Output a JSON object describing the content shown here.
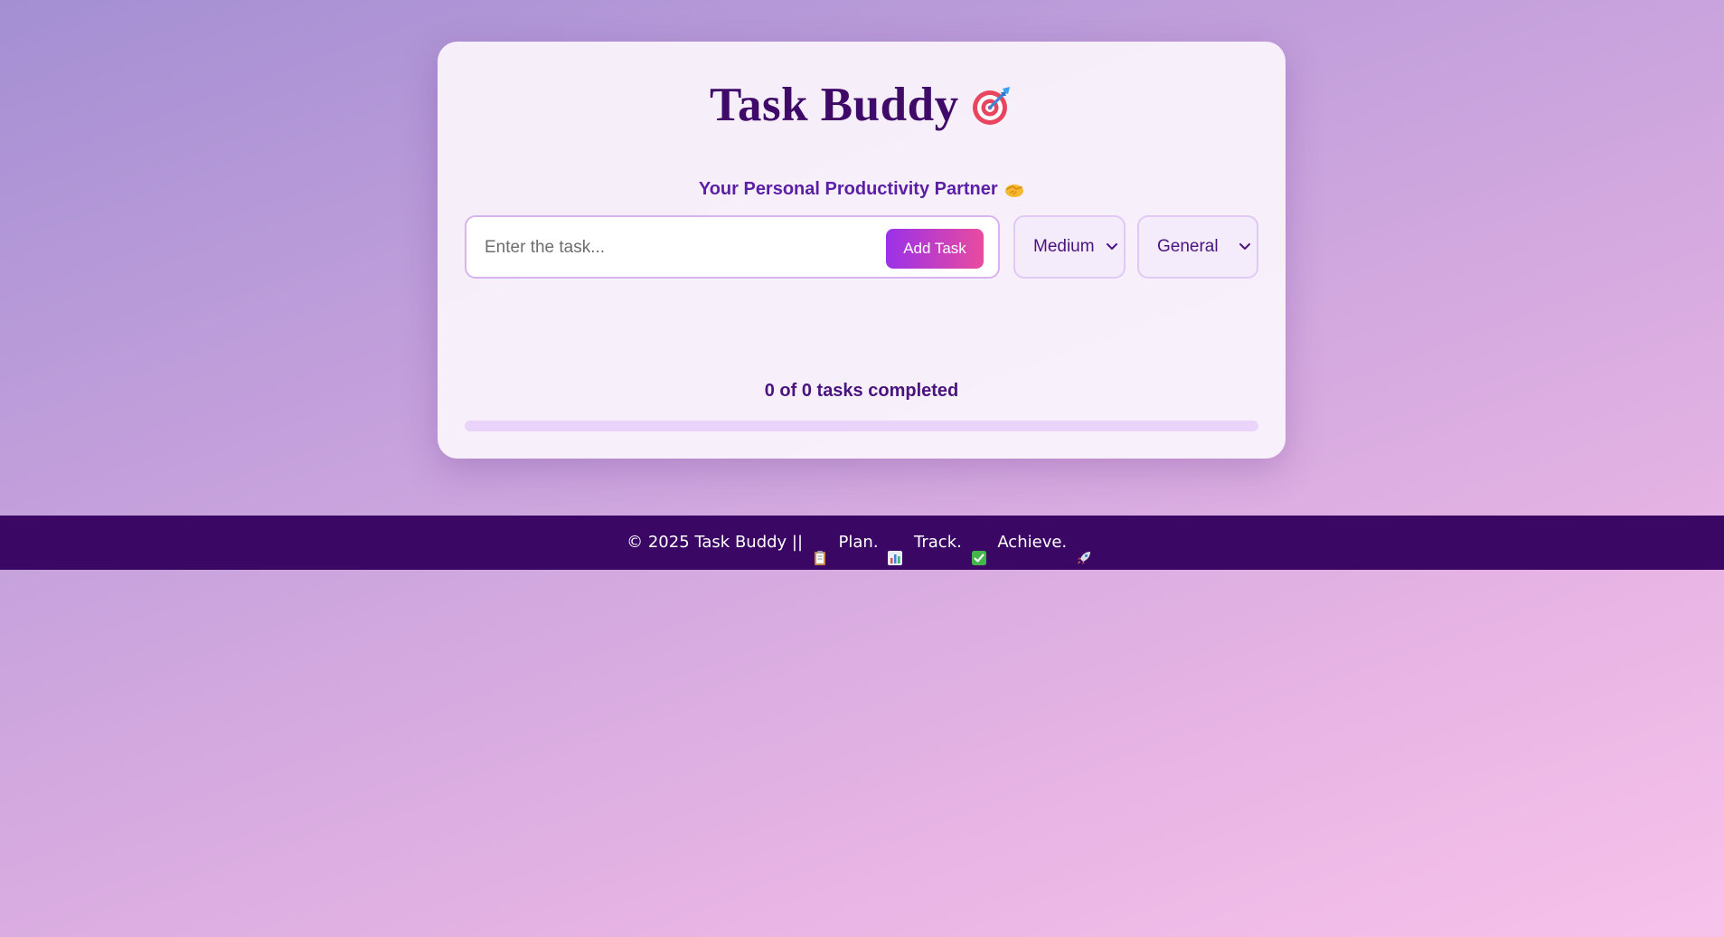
{
  "header": {
    "title": "Task Buddy",
    "title_icon": "target-dart-icon",
    "subtitle": "Your Personal Productivity Partner",
    "subtitle_icon": "handshake-icon"
  },
  "form": {
    "task_placeholder": "Enter the task...",
    "task_value": "",
    "add_button_label": "Add Task",
    "priority_selected": "Medium",
    "category_selected": "General"
  },
  "progress": {
    "text": "0 of 0 tasks completed",
    "completed": 0,
    "total": 0,
    "fraction": 0
  },
  "footer": {
    "copyright": "© 2025 Task Buddy ||",
    "plan": "Plan.",
    "track": "Track.",
    "achieve": "Achieve.",
    "icons": [
      "clipboard-icon",
      "bar-chart-icon",
      "check-box-icon",
      "rocket-icon"
    ]
  },
  "colors": {
    "primary_dark": "#3b0764",
    "accent_purple": "#9a31e8",
    "accent_pink": "#e94b9f"
  }
}
